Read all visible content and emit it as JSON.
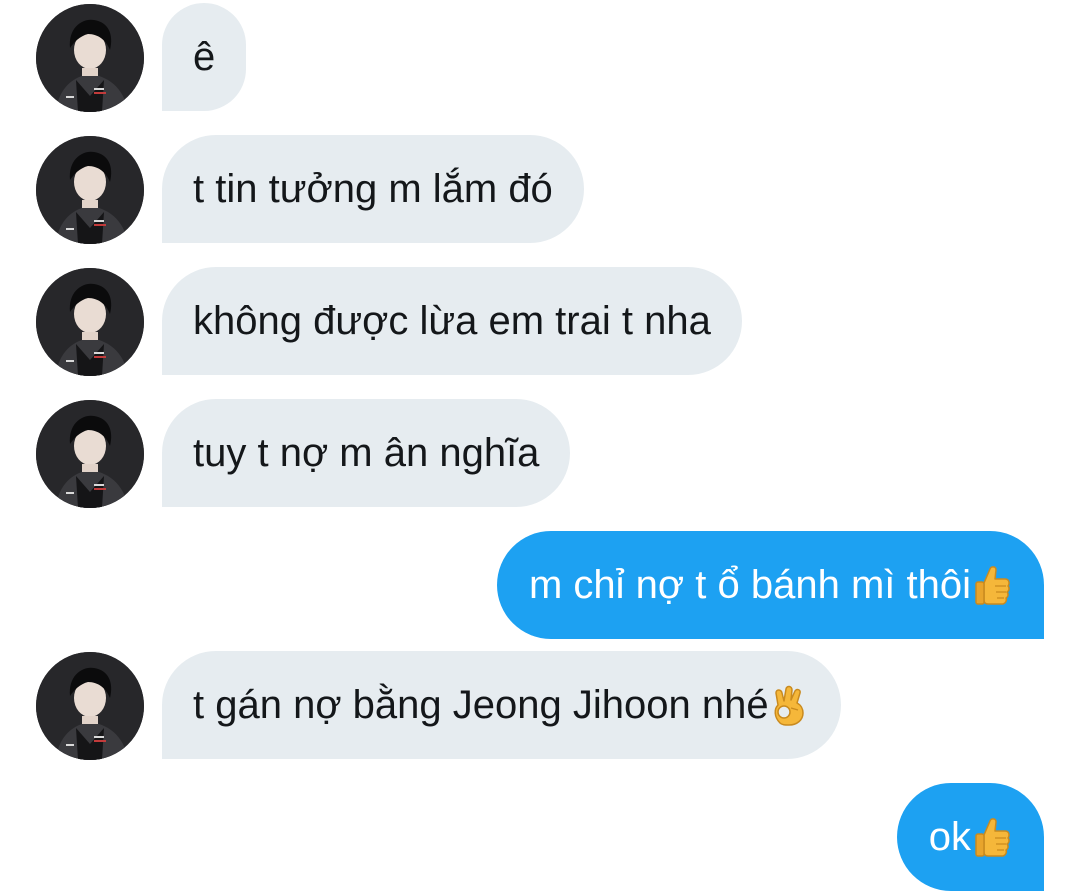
{
  "conversation": {
    "messages": [
      {
        "direction": "incoming",
        "text": "ê"
      },
      {
        "direction": "incoming",
        "text": "t tin tưởng m lắm đó"
      },
      {
        "direction": "incoming",
        "text": "không được lừa em trai t nha"
      },
      {
        "direction": "incoming",
        "text": "tuy t nợ m ân nghĩa"
      },
      {
        "direction": "outgoing",
        "text": "m chỉ nợ t ổ bánh mì thôi",
        "emoji": "thumbs-up-icon"
      },
      {
        "direction": "incoming",
        "text": "t gán nợ bằng Jeong Jihoon nhé",
        "emoji": "ok-hand-icon"
      },
      {
        "direction": "outgoing",
        "text": "ok",
        "emoji": "thumbs-up-icon"
      }
    ]
  },
  "colors": {
    "incoming_bubble": "#e6ecf0",
    "incoming_text": "#14171a",
    "outgoing_bubble": "#1da1f2",
    "outgoing_text": "#ffffff",
    "background": "#ffffff"
  }
}
